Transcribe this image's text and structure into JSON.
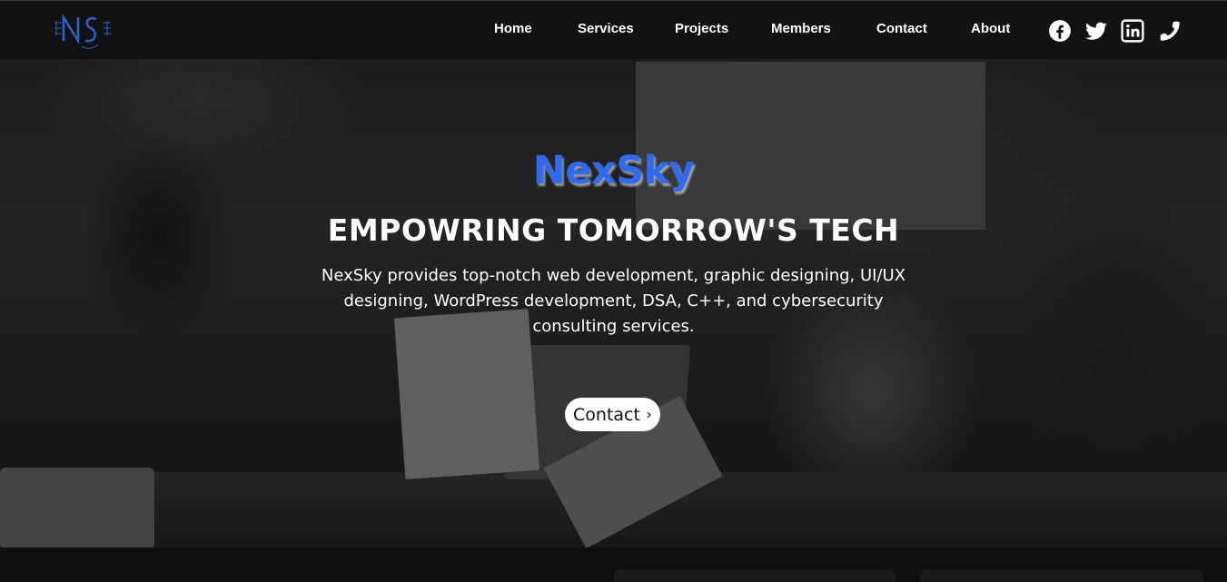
{
  "brand": {
    "name": "NexSky",
    "logo_icon": "ns-monogram-logo",
    "accent_color": "#2f6bf2"
  },
  "nav": {
    "items": [
      {
        "label": "Home"
      },
      {
        "label": "Services"
      },
      {
        "label": "Projects"
      },
      {
        "label": "Members"
      },
      {
        "label": "Contact"
      },
      {
        "label": "About"
      }
    ],
    "social": [
      {
        "icon": "facebook-icon"
      },
      {
        "icon": "twitter-icon"
      },
      {
        "icon": "linkedin-icon"
      },
      {
        "icon": "phone-icon"
      }
    ]
  },
  "hero": {
    "title": "NexSky",
    "headline": "EMPOWRING TOMORROW'S TECH",
    "description": "NexSky provides top-notch web development, graphic designing, UI/UX designing, WordPress development, DSA, C++, and cybersecurity consulting services.",
    "cta_label": "Contact",
    "cta_icon": "chevron-right-icon"
  }
}
